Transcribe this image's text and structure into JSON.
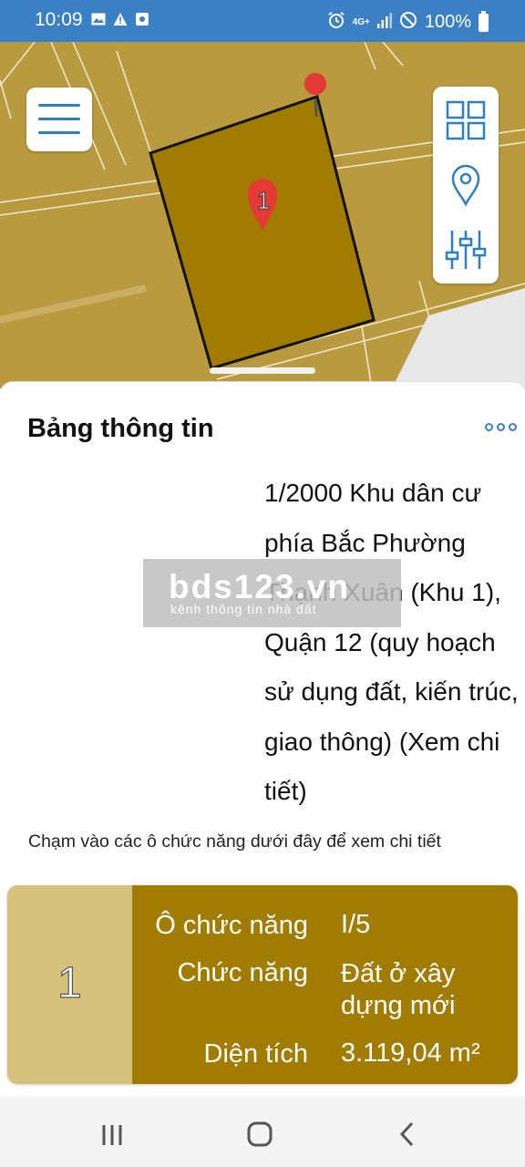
{
  "status_bar": {
    "time": "10:09",
    "network_label": "4G+",
    "battery_percent": "100%"
  },
  "map": {
    "parcel_marker_label": "1",
    "colors": {
      "land": "#b99a3f",
      "parcel": "#a27c00",
      "pin": "#e53935"
    }
  },
  "sheet": {
    "title": "Bảng thông tin",
    "plan_description": "1/2000 Khu dân cư phía Bắc Phường Thạnh Xuân (Khu 1), Quận 12 (quy hoạch sử dụng đất, kiến trúc, giao thông) (Xem chi tiết)",
    "watermark_brand": "bds123.vn",
    "watermark_tagline": "kênh thông tin nhà đất",
    "hint": "Chạm vào các ô chức năng dưới đây để xem chi tiết"
  },
  "function_card": {
    "number": "1",
    "rows": [
      {
        "label": "Ô chức năng",
        "value": "I/5"
      },
      {
        "label": "Chức năng",
        "value": "Đất ở xây dựng mới"
      },
      {
        "label": "Diện tích",
        "value": "3.119,04 m²"
      }
    ]
  },
  "icons": [
    "menu-icon",
    "grid-icon",
    "location-pin-icon",
    "sliders-icon",
    "more-icon",
    "recents-icon",
    "home-icon",
    "back-icon"
  ]
}
